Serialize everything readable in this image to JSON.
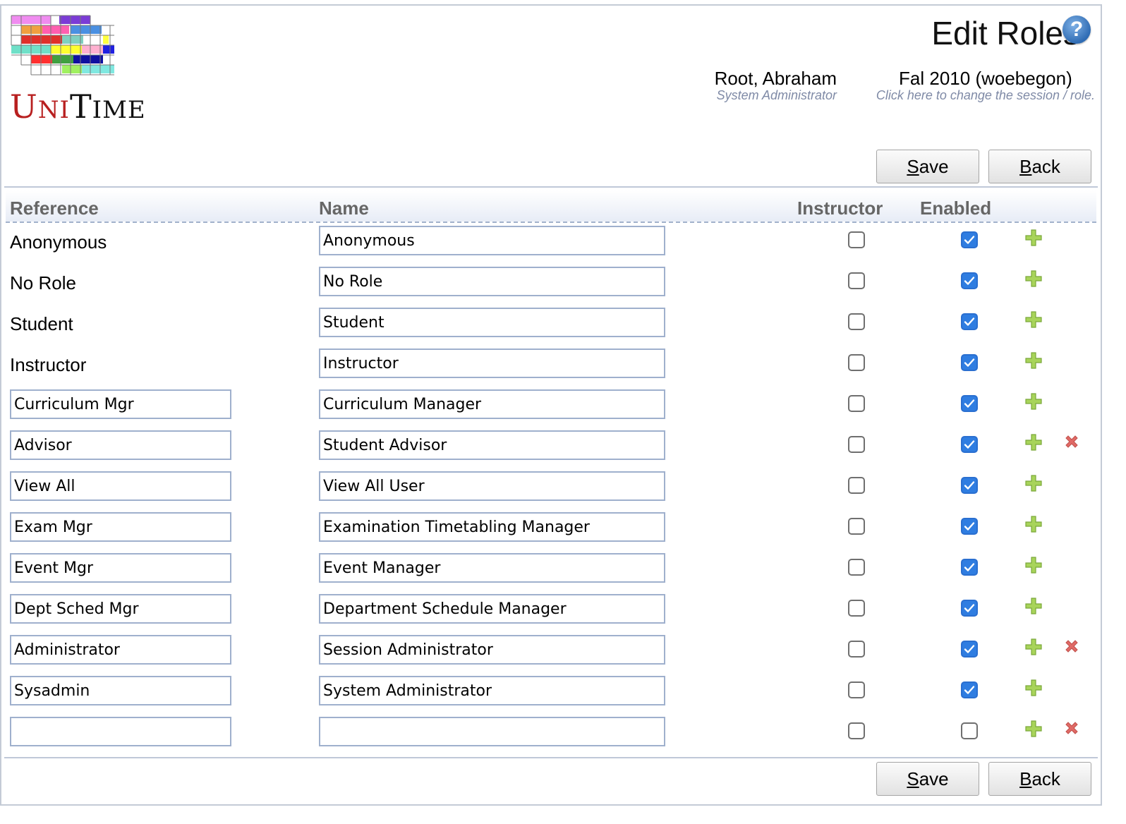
{
  "app": {
    "logo_text": "UniTime",
    "logo_u": "U",
    "logo_ni": "NI",
    "logo_t": "T",
    "logo_ime": "IME"
  },
  "header": {
    "title": "Edit Roles",
    "help_glyph": "?",
    "user_name": "Root, Abraham",
    "user_role": "System Administrator",
    "session_name": "Fal 2010 (woebegon)",
    "session_hint": "Click here to change the session / role."
  },
  "buttons": {
    "save_first": "S",
    "save_rest": "ave",
    "back_first": "B",
    "back_rest": "ack"
  },
  "table": {
    "headers": {
      "reference": "Reference",
      "name": "Name",
      "instructor": "Instructor",
      "enabled": "Enabled"
    },
    "rows": [
      {
        "reference": "Anonymous",
        "name": "Anonymous",
        "editable_ref": false,
        "instructor": false,
        "enabled": true,
        "deletable": false
      },
      {
        "reference": "No Role",
        "name": "No Role",
        "editable_ref": false,
        "instructor": false,
        "enabled": true,
        "deletable": false
      },
      {
        "reference": "Student",
        "name": "Student",
        "editable_ref": false,
        "instructor": false,
        "enabled": true,
        "deletable": false
      },
      {
        "reference": "Instructor",
        "name": "Instructor",
        "editable_ref": false,
        "instructor": false,
        "enabled": true,
        "deletable": false
      },
      {
        "reference": "Curriculum Mgr",
        "name": "Curriculum Manager",
        "editable_ref": true,
        "instructor": false,
        "enabled": true,
        "deletable": false
      },
      {
        "reference": "Advisor",
        "name": "Student Advisor",
        "editable_ref": true,
        "instructor": false,
        "enabled": true,
        "deletable": true
      },
      {
        "reference": "View All",
        "name": "View All User",
        "editable_ref": true,
        "instructor": false,
        "enabled": true,
        "deletable": false
      },
      {
        "reference": "Exam Mgr",
        "name": "Examination Timetabling Manager",
        "editable_ref": true,
        "instructor": false,
        "enabled": true,
        "deletable": false
      },
      {
        "reference": "Event Mgr",
        "name": "Event Manager",
        "editable_ref": true,
        "instructor": false,
        "enabled": true,
        "deletable": false
      },
      {
        "reference": "Dept Sched Mgr",
        "name": "Department Schedule Manager",
        "editable_ref": true,
        "instructor": false,
        "enabled": true,
        "deletable": false
      },
      {
        "reference": "Administrator",
        "name": "Session Administrator",
        "editable_ref": true,
        "instructor": false,
        "enabled": true,
        "deletable": true
      },
      {
        "reference": "Sysadmin",
        "name": "System Administrator",
        "editable_ref": true,
        "instructor": false,
        "enabled": true,
        "deletable": false
      },
      {
        "reference": "",
        "name": "",
        "editable_ref": true,
        "instructor": false,
        "enabled": false,
        "deletable": true
      }
    ]
  },
  "icons": {
    "add": "add-icon",
    "delete": "delete-icon",
    "help": "help-icon"
  },
  "colors": {
    "checkbox_checked": "#2f7de1",
    "add_icon": "#9ccc3c",
    "delete_icon": "#d9534f",
    "hint_text": "#7f8aa6"
  }
}
